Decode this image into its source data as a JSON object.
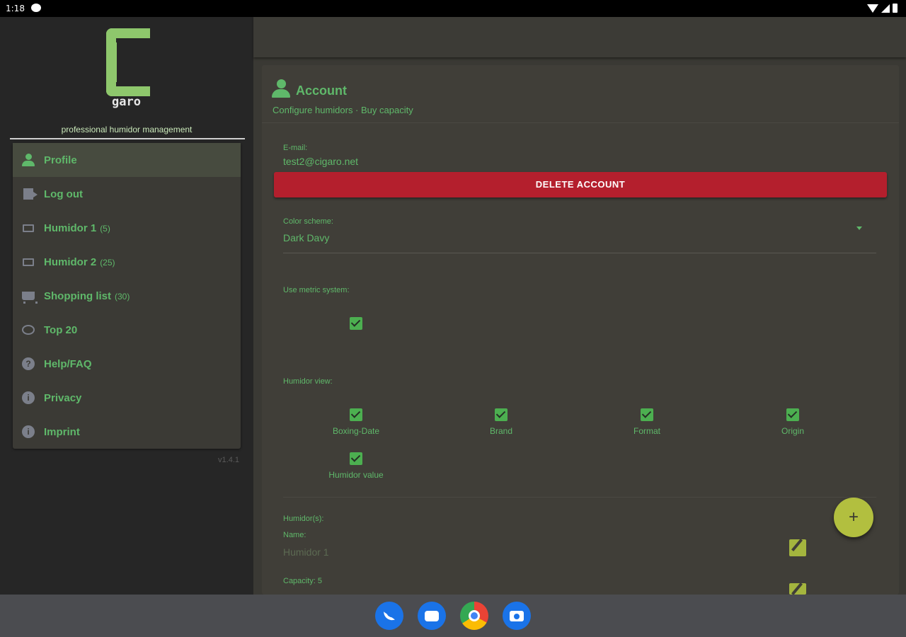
{
  "status_bar": {
    "time": "1:18"
  },
  "sidebar": {
    "logo_text": "garo",
    "tagline": "professional humidor management",
    "items": [
      {
        "label": "Profile",
        "count": ""
      },
      {
        "label": "Log out",
        "count": ""
      },
      {
        "label": "Humidor 1",
        "count": "(5)"
      },
      {
        "label": "Humidor 2",
        "count": "(25)"
      },
      {
        "label": "Shopping list",
        "count": "(30)"
      },
      {
        "label": "Top 20",
        "count": ""
      },
      {
        "label": "Help/FAQ",
        "count": ""
      },
      {
        "label": "Privacy",
        "count": ""
      },
      {
        "label": "Imprint",
        "count": ""
      }
    ],
    "version": "v1.4.1"
  },
  "account": {
    "title": "Account",
    "subtitle": "Configure humidors · Buy capacity",
    "email_label": "E-mail:",
    "email_value": "test2@cigaro.net",
    "delete_label": "DELETE ACCOUNT",
    "color_scheme_label": "Color scheme:",
    "color_scheme_value": "Dark Davy",
    "metric_label": "Use metric system:",
    "metric_checked": true,
    "humidor_view_label": "Humidor view:",
    "view_options": [
      {
        "label": "Boxing-Date",
        "checked": true
      },
      {
        "label": "Brand",
        "checked": true
      },
      {
        "label": "Format",
        "checked": true
      },
      {
        "label": "Origin",
        "checked": true
      },
      {
        "label": "Humidor value",
        "checked": true
      }
    ],
    "humidors_label": "Humidor(s):",
    "name_label": "Name:",
    "name_placeholder": "Humidor 1",
    "capacity_label": "Capacity: 5"
  },
  "fab": {
    "label": "+"
  }
}
